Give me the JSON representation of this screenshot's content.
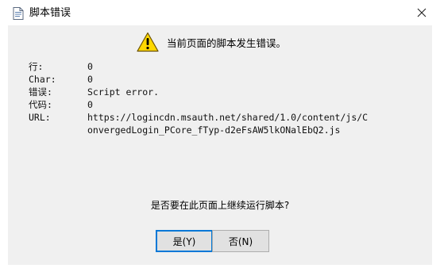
{
  "window": {
    "title": "脚本错误",
    "close_symbol": "✕"
  },
  "message": {
    "header": "当前页面的脚本发生错误。",
    "details": [
      {
        "label": "行:",
        "value": "0"
      },
      {
        "label": "Char:",
        "value": "0"
      },
      {
        "label": "错误:",
        "value": "Script error."
      },
      {
        "label": "代码:",
        "value": "0"
      },
      {
        "label": "URL:",
        "value": "https://logincdn.msauth.net/shared/1.0/content/js/ConvergedLogin_PCore_fTyp-d2eFsAW5lkONalEbQ2.js"
      }
    ],
    "question": "是否要在此页面上继续运行脚本?"
  },
  "buttons": {
    "yes": "是(Y)",
    "no": "否(N)"
  },
  "colors": {
    "content_bg": "#f0f0f0",
    "warning_fill": "#ffd800",
    "default_button_border": "#0078d7"
  },
  "icons": {
    "title": "document-icon",
    "header": "warning-icon",
    "close": "close-icon"
  }
}
